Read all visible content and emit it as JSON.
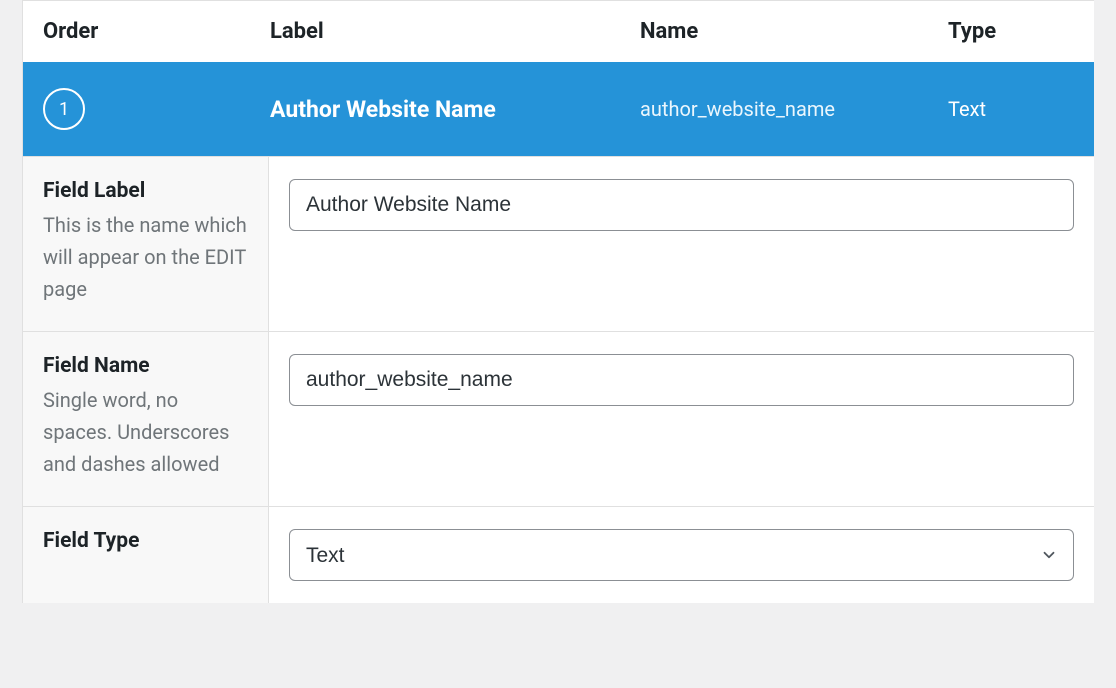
{
  "header": {
    "order": "Order",
    "label": "Label",
    "name": "Name",
    "type": "Type"
  },
  "row": {
    "order": "1",
    "label": "Author Website Name",
    "name": "author_website_name",
    "type": "Text"
  },
  "settings": {
    "field_label": {
      "title": "Field Label",
      "desc": "This is the name which will appear on the EDIT page",
      "value": "Author Website Name"
    },
    "field_name": {
      "title": "Field Name",
      "desc": "Single word, no spaces. Underscores and dashes allowed",
      "value": "author_website_name"
    },
    "field_type": {
      "title": "Field Type",
      "value": "Text"
    }
  }
}
